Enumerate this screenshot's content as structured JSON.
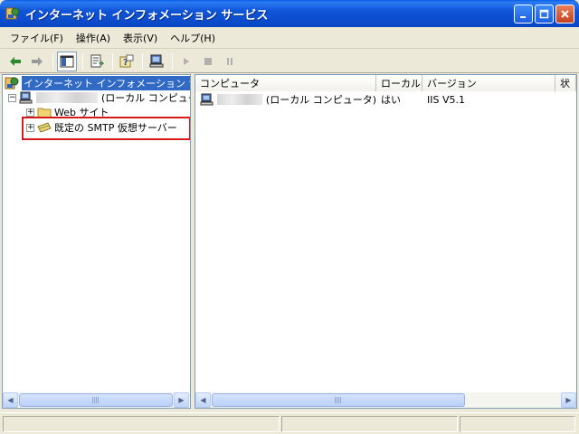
{
  "window": {
    "title": "インターネット インフォメーション サービス",
    "icon": "iis-app-icon",
    "buttons": [
      "minimize-icon",
      "maximize-icon",
      "close-icon"
    ]
  },
  "menu": {
    "items": [
      "ファイル(F)",
      "操作(A)",
      "表示(V)",
      "ヘルプ(H)"
    ]
  },
  "toolbar": {
    "icons": [
      "back-arrow-icon",
      "forward-arrow-icon",
      "show-hide-tree-icon",
      "export-list-icon",
      "help-icon",
      "computer-icon",
      "play-icon",
      "stop-icon",
      "pause-icon"
    ]
  },
  "tree": {
    "root": "インターネット インフォメーション サービス",
    "computer": "(ローカル コンピュータ)",
    "children": [
      "Web サイト",
      "既定の SMTP 仮想サーバー"
    ]
  },
  "list": {
    "columns": [
      "コンピュータ",
      "ローカル",
      "バージョン",
      "状"
    ],
    "rows": [
      {
        "computer": "(ローカル コンピュータ)",
        "local": "はい",
        "version": "IIS V5.1"
      }
    ]
  },
  "colors": {
    "titlebar": "#0A55D8",
    "selection": "#316AC5",
    "highlight_box": "#D41A1A"
  }
}
